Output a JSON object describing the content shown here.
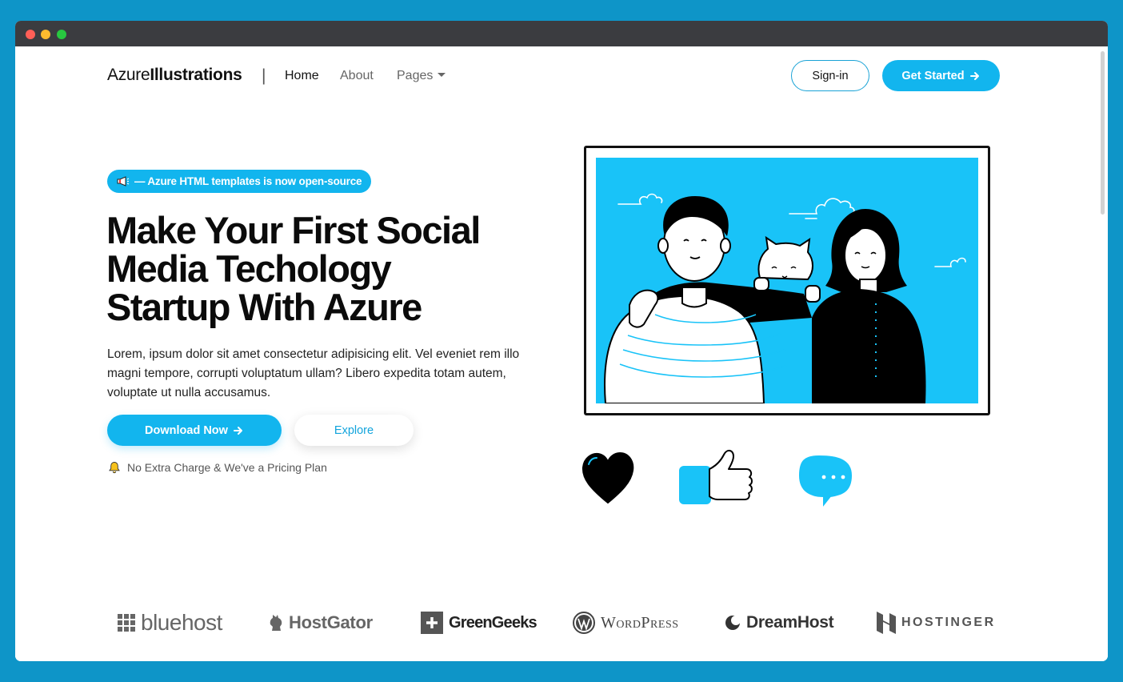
{
  "nav": {
    "brand_light": "Azure",
    "brand_bold": "Illustrations",
    "separator": "|",
    "links": [
      "Home",
      "About",
      "Pages"
    ],
    "signin_label": "Sign-in",
    "get_started_label": "Get Started"
  },
  "hero": {
    "badge_text": "— Azure HTML templates is now open-source",
    "title_line1": "Make Your First Social",
    "title_line2": "Media Techology",
    "title_line3": "Startup With Azure",
    "description": "Lorem, ipsum dolor sit amet consectetur adipisicing elit. Vel eveniet rem illo magni tempore, corrupti voluptatum ullam? Libero expedita totam autem, voluptate ut nulla accusamus.",
    "download_label": "Download Now",
    "explore_label": "Explore",
    "note": "No Extra Charge & We've a Pricing Plan"
  },
  "logos": {
    "bluehost": "bluehost",
    "hostgator": "HostGator",
    "greengeeks": "GreenGeeks",
    "wordpress": "WordPress",
    "dreamhost": "DreamHost",
    "hostinger": "HOSTINGER"
  },
  "icons": {
    "megaphone": "megaphone-icon",
    "arrow": "arrow-right-icon",
    "bell": "bell-icon",
    "heart": "heart-icon",
    "thumbs_up": "thumbs-up-icon",
    "chat": "chat-bubble-icon"
  },
  "colors": {
    "accent": "#12b5ee",
    "page_background": "#0e95c8",
    "titlebar": "#3b3c40",
    "text_dark": "#0b0b0b"
  }
}
